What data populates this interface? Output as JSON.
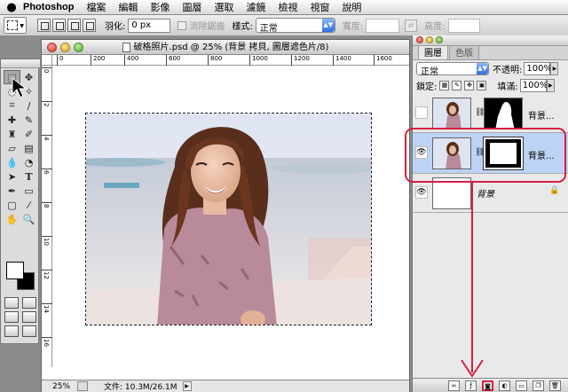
{
  "menubar": {
    "apple_glyph": "",
    "app_name": "Photoshop",
    "items": [
      "檔案",
      "編輯",
      "影像",
      "圖層",
      "選取",
      "濾鏡",
      "檢視",
      "視窗",
      "說明"
    ]
  },
  "options": {
    "feather_label": "羽化:",
    "feather_value": "0 px",
    "antialias_label": "消除鋸齒",
    "style_label": "樣式:",
    "style_value": "正常",
    "width_label": "寬度:",
    "height_label": "高度:"
  },
  "document": {
    "title": "破格照片.psd @ 25% (背景 拷貝, 圖層遮色片/8)",
    "ruler_h": [
      "0",
      "200",
      "400",
      "600",
      "800",
      "1000",
      "1200",
      "1400",
      "1600"
    ],
    "ruler_v": [
      "0",
      "2",
      "4",
      "6",
      "8",
      "10",
      "12",
      "14",
      "16"
    ],
    "zoom": "25%",
    "file_info": "文件: 10.3M/26.1M"
  },
  "layers_panel": {
    "tabs": [
      "圖層",
      "色版"
    ],
    "blend_mode": "正常",
    "opacity_label": "不透明:",
    "opacity_value": "100%",
    "lock_label": "鎖定:",
    "fill_label": "填滿:",
    "fill_value": "100%",
    "layers": [
      {
        "name": "背景..."
      },
      {
        "name": "背景..."
      },
      {
        "name": "背景"
      }
    ]
  },
  "colors": {
    "annotation": "#d62040",
    "selected_layer": "#bcd3f5"
  }
}
